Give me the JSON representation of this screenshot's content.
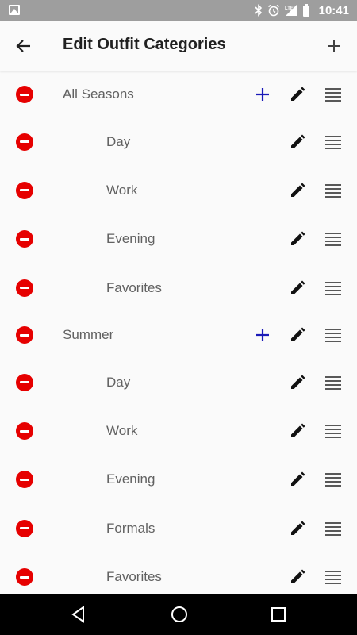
{
  "status_bar": {
    "time": "10:41",
    "icons": [
      "image-icon",
      "bluetooth-icon",
      "alarm-icon",
      "lte-signal-icon",
      "battery-icon"
    ]
  },
  "app_bar": {
    "title": "Edit Outfit Categories",
    "back_icon": "arrow-back-icon",
    "add_icon": "plus-icon"
  },
  "categories": [
    {
      "label": "All Seasons",
      "level": "parent",
      "can_add": true
    },
    {
      "label": "Day",
      "level": "child",
      "can_add": false
    },
    {
      "label": "Work",
      "level": "child",
      "can_add": false
    },
    {
      "label": "Evening",
      "level": "child",
      "can_add": false
    },
    {
      "label": "Favorites",
      "level": "child",
      "can_add": false
    },
    {
      "label": "Summer",
      "level": "parent",
      "can_add": true
    },
    {
      "label": "Day",
      "level": "child",
      "can_add": false
    },
    {
      "label": "Work",
      "level": "child",
      "can_add": false
    },
    {
      "label": "Evening",
      "level": "child",
      "can_add": false
    },
    {
      "label": "Formals",
      "level": "child",
      "can_add": false
    },
    {
      "label": "Favorites",
      "level": "child",
      "can_add": false
    }
  ],
  "colors": {
    "remove": "#e60000",
    "add_sub": "#1a1ab8",
    "status_bar": "#9e9e9e",
    "nav_bar": "#000000"
  },
  "nav_bar": [
    "back-triangle-icon",
    "home-circle-icon",
    "recents-square-icon"
  ]
}
